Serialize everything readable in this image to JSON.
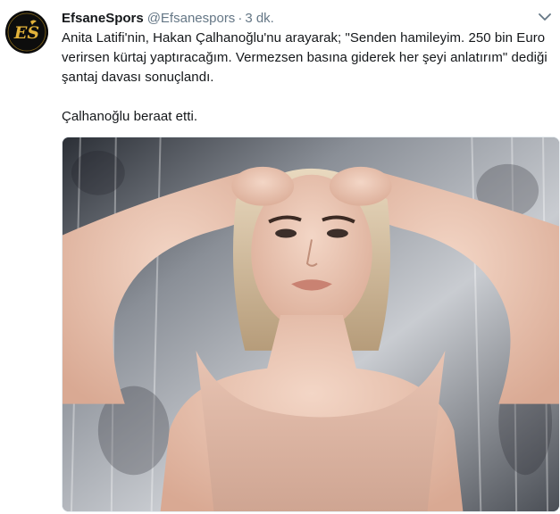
{
  "tweet": {
    "display_name": "EfsaneSpors",
    "handle": "@Efsanespors",
    "separator": "·",
    "time": "3 dk.",
    "text_paragraph_1": "Anita Latifi'nin, Hakan Çalhanoğlu'nu arayarak; \"Senden hamileyim. 250 bin Euro verirsen kürtaj yaptıracağım. Vermezsen basına giderek her şeyi anlatırım\" dediği şantaj davası sonuçlandı.",
    "text_paragraph_2": "Çalhanoğlu beraat etti.",
    "avatar_logo_text": "ES",
    "caret_icon": "chevron-down-icon",
    "media": {
      "kind": "photo",
      "description_visible": false
    }
  },
  "colors": {
    "primary_text": "#14171a",
    "secondary_text": "#657786",
    "avatar_background": "#0d0d0d",
    "logo_gold": "#d9a521"
  }
}
